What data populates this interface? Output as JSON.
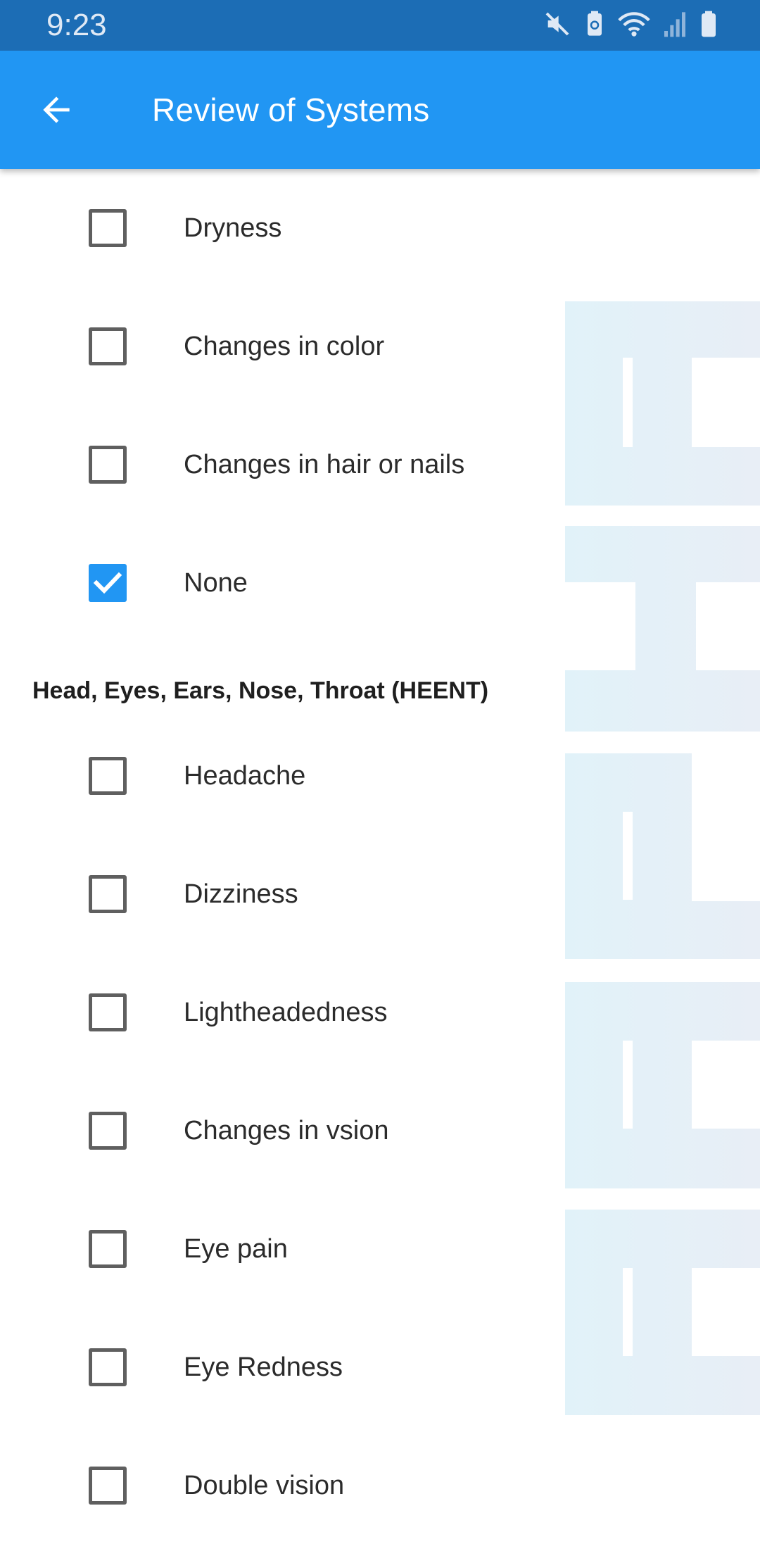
{
  "status_bar": {
    "time": "9:23",
    "icons": [
      "mute-icon",
      "battery-saver-icon",
      "wifi-icon",
      "signal-icon",
      "battery-icon"
    ]
  },
  "app_bar": {
    "title": "Review of Systems",
    "back_icon": "arrow-back-icon"
  },
  "skin_items": [
    {
      "label": "Dryness",
      "checked": false
    },
    {
      "label": "Changes in color",
      "checked": false
    },
    {
      "label": "Changes in hair or nails",
      "checked": false
    },
    {
      "label": "None",
      "checked": true
    }
  ],
  "heent": {
    "heading": "Head, Eyes, Ears, Nose, Throat (HEENT)",
    "items": [
      {
        "label": "Headache",
        "checked": false
      },
      {
        "label": "Dizziness",
        "checked": false
      },
      {
        "label": "Lightheadedness",
        "checked": false
      },
      {
        "label": "Changes in vsion",
        "checked": false
      },
      {
        "label": "Eye pain",
        "checked": false
      },
      {
        "label": "Eye Redness",
        "checked": false
      },
      {
        "label": "Double vision",
        "checked": false
      }
    ]
  },
  "colors": {
    "status_bar": "#1c6db5",
    "app_bar": "#2196f3",
    "checkbox_checked": "#2196f3",
    "checkbox_border": "#5f5f5f",
    "watermark": "#e3f1f8"
  }
}
